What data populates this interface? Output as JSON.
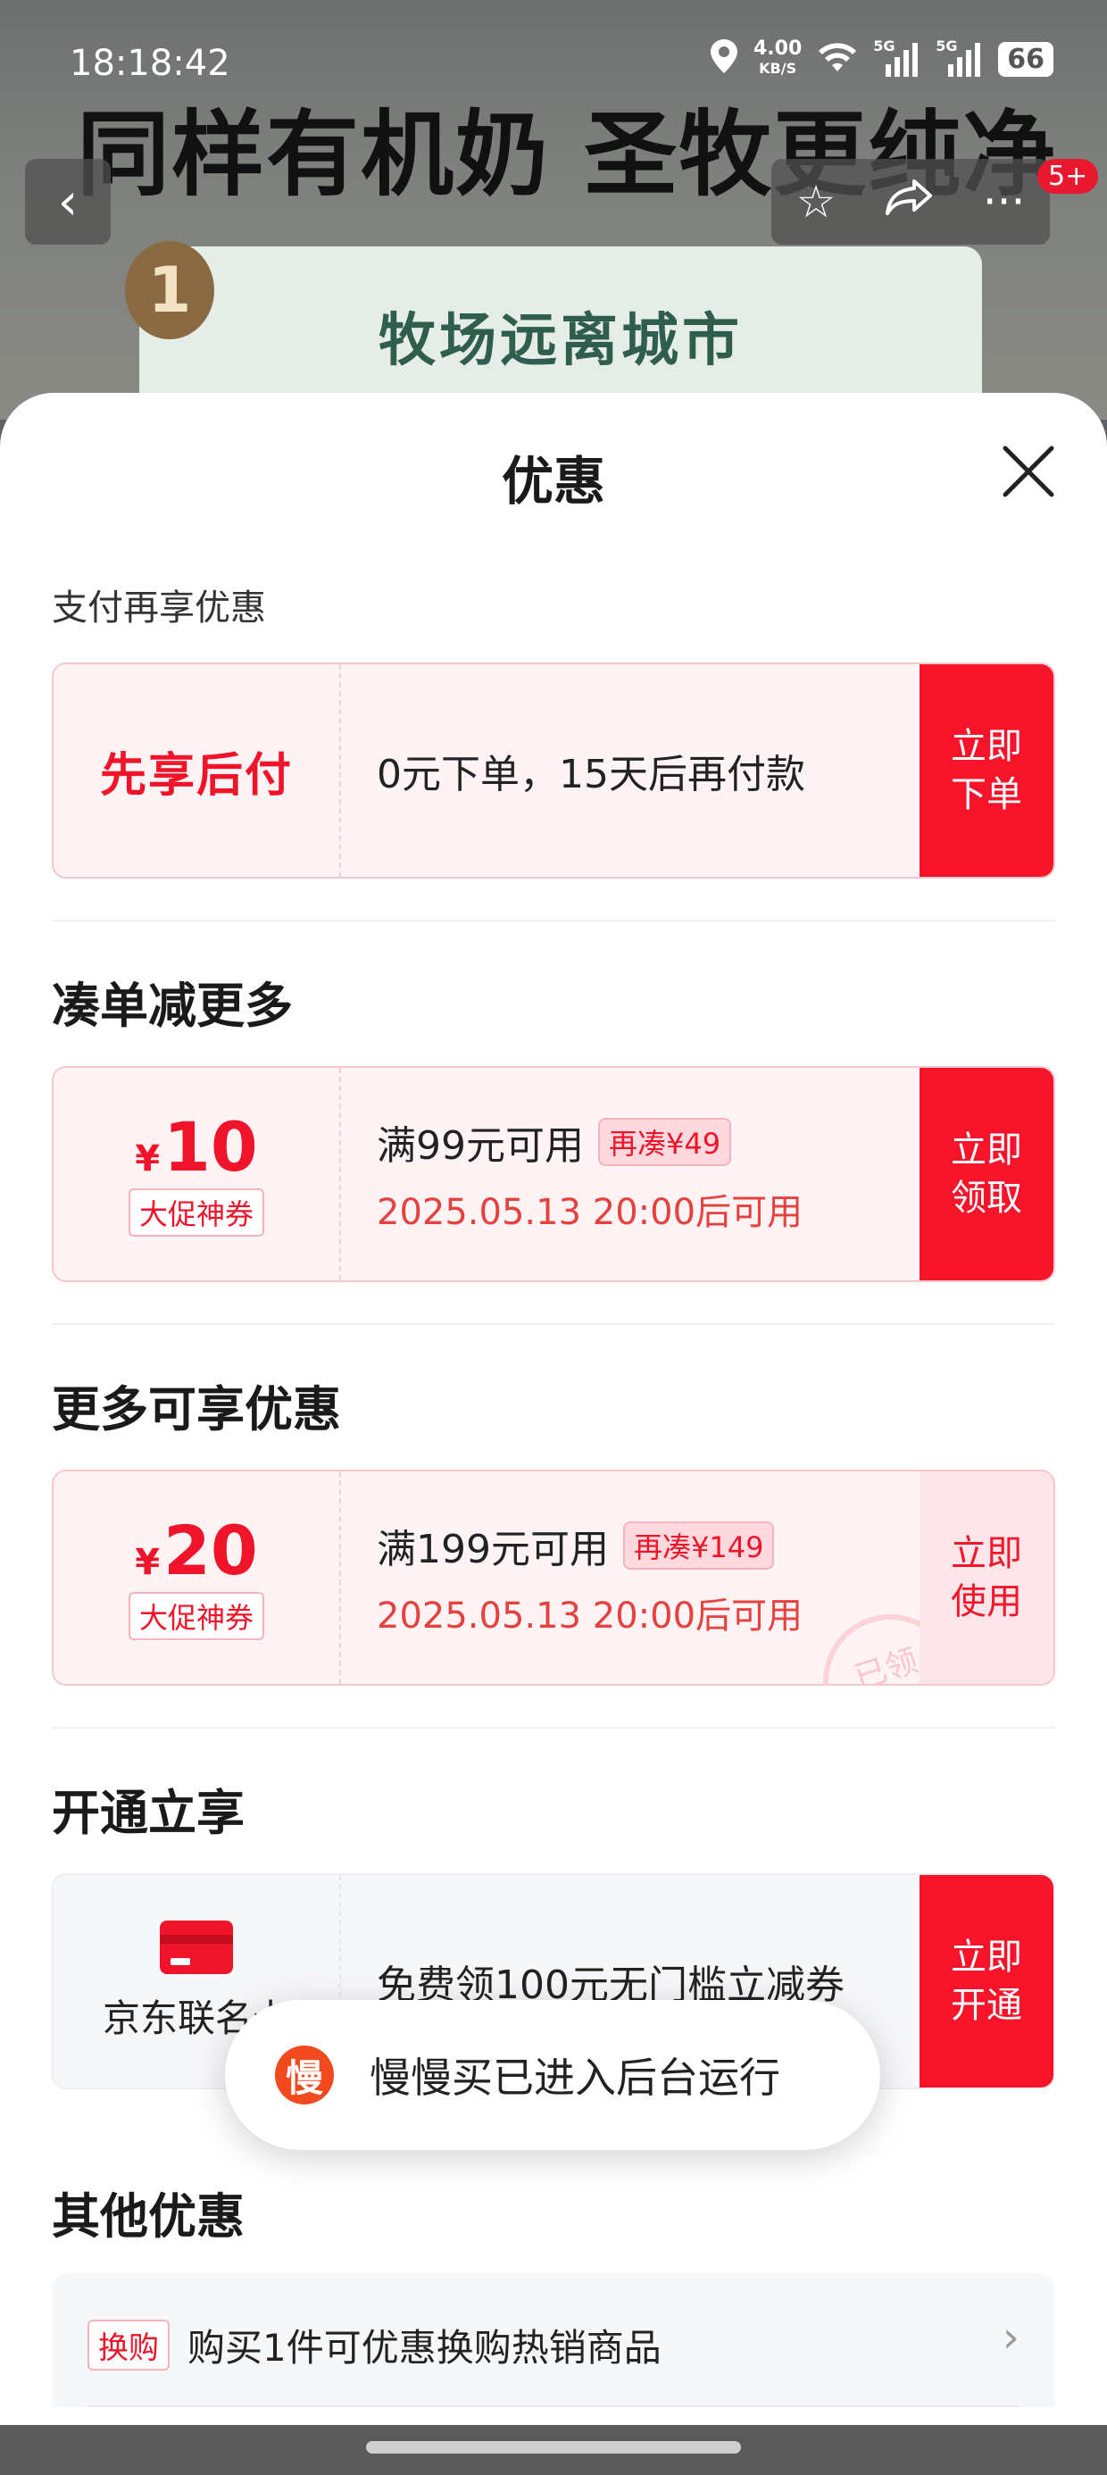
{
  "status_bar": {
    "time": "18:18:42",
    "net_speed_value": "4.00",
    "net_speed_unit": "KB/S",
    "signal1_label": "5G",
    "signal2_label": "5G",
    "battery": "66"
  },
  "background": {
    "banner_text": "同样有机奶 圣牧更纯净",
    "promo_number": "1",
    "promo_text": "牧场远离城市"
  },
  "header_nav": {
    "cart_badge": "5+"
  },
  "sheet": {
    "title": "优惠"
  },
  "sections": {
    "pay_later": {
      "label": "支付再享优惠",
      "left_text": "先享后付",
      "desc": "0元下单，15天后再付款",
      "action": "立即下单"
    },
    "bundle": {
      "title": "凑单减更多",
      "currency": "¥",
      "amount": "10",
      "coupon_type": "大促神券",
      "condition": "满99元可用",
      "add_more": "再凑¥49",
      "valid_from": "2025.05.13 20:00后可用",
      "action": "立即领取"
    },
    "more": {
      "title": "更多可享优惠",
      "currency": "¥",
      "amount": "20",
      "coupon_type": "大促神券",
      "condition": "满199元可用",
      "add_more": "再凑¥149",
      "valid_from": "2025.05.13 20:00后可用",
      "stamp": "已领",
      "action": "立即使用"
    },
    "membership": {
      "title": "开通立享",
      "card_name": "京东联名卡",
      "desc": "免费领100元无门槛立减券",
      "action": "立即开通"
    },
    "other": {
      "title": "其他优惠",
      "tag": "换购",
      "text": "购买1件可优惠换购热销商品"
    }
  },
  "toast": {
    "logo_char": "慢",
    "message": "慢慢买已进入后台运行"
  },
  "colors": {
    "accent": "#f5142a",
    "card_bg": "#fff4f5"
  }
}
